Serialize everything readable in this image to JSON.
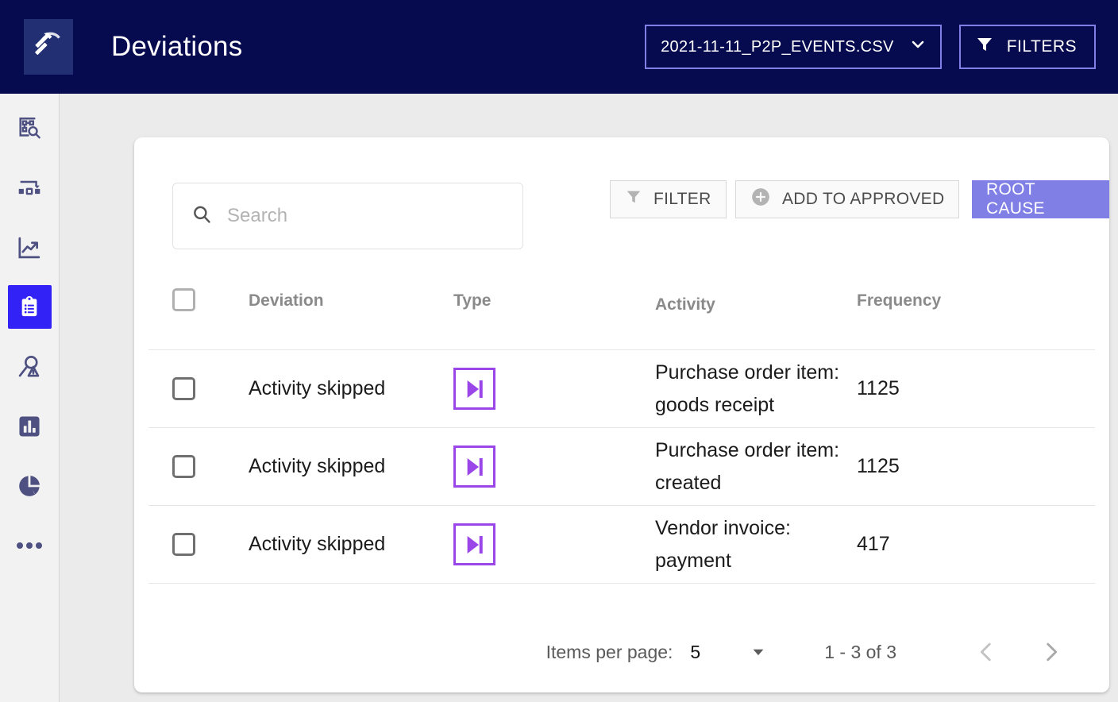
{
  "appbar": {
    "logo_icon": "pickaxe-icon",
    "title": "Deviations",
    "file_select": {
      "value": "2021-11-11_P2P_EVENTS.CSV",
      "caret_icon": "chevron-down-icon"
    },
    "filters_button": {
      "label": "FILTERS",
      "icon": "funnel-icon"
    },
    "bg_color": "#060a4e",
    "accent_color": "#7f7fe6"
  },
  "sidebar": {
    "items": [
      {
        "name": "process-explorer",
        "icon": "process-search-icon",
        "active": false
      },
      {
        "name": "process-flow",
        "icon": "flow-chart-icon",
        "active": false
      },
      {
        "name": "trends",
        "icon": "trend-line-icon",
        "active": false
      },
      {
        "name": "deviations",
        "icon": "clipboard-list-icon",
        "active": true
      },
      {
        "name": "root-cause",
        "icon": "magnifier-warning-icon",
        "active": false
      },
      {
        "name": "bar-analytics",
        "icon": "bar-chart-icon",
        "active": false
      },
      {
        "name": "pie-analytics",
        "icon": "pie-chart-icon",
        "active": false
      },
      {
        "name": "more",
        "icon": "ellipsis-icon",
        "active": false
      }
    ],
    "active_color": "#3322f5",
    "icon_color": "#4d5080"
  },
  "toolbar": {
    "search": {
      "placeholder": "Search",
      "value": "",
      "icon": "search-icon"
    },
    "filter_button": {
      "label": "FILTER",
      "icon": "funnel-icon"
    },
    "add_button": {
      "label": "ADD TO APPROVED",
      "icon": "plus-circle-icon"
    },
    "root_cause_button": {
      "label": "ROOT CAUSE",
      "color": "#7f7fe6"
    }
  },
  "table": {
    "columns": [
      "Deviation",
      "Type",
      "Activity",
      "Frequency"
    ],
    "select_all_checked": false,
    "rows": [
      {
        "checked": false,
        "deviation": "Activity skipped",
        "type_icon": "skip-next-icon",
        "activity": "Purchase order item: goods receipt",
        "frequency": "1125"
      },
      {
        "checked": false,
        "deviation": "Activity skipped",
        "type_icon": "skip-next-icon",
        "activity": "Purchase order item: created",
        "frequency": "1125"
      },
      {
        "checked": false,
        "deviation": "Activity skipped",
        "type_icon": "skip-next-icon",
        "activity": "Vendor invoice: payment",
        "frequency": "417"
      }
    ]
  },
  "paginator": {
    "items_per_page_label": "Items per page:",
    "items_per_page_value": "5",
    "range_label": "1 - 3 of 3",
    "prev_icon": "chevron-left-icon",
    "next_icon": "chevron-right-icon",
    "caret_icon": "caret-down-icon"
  }
}
